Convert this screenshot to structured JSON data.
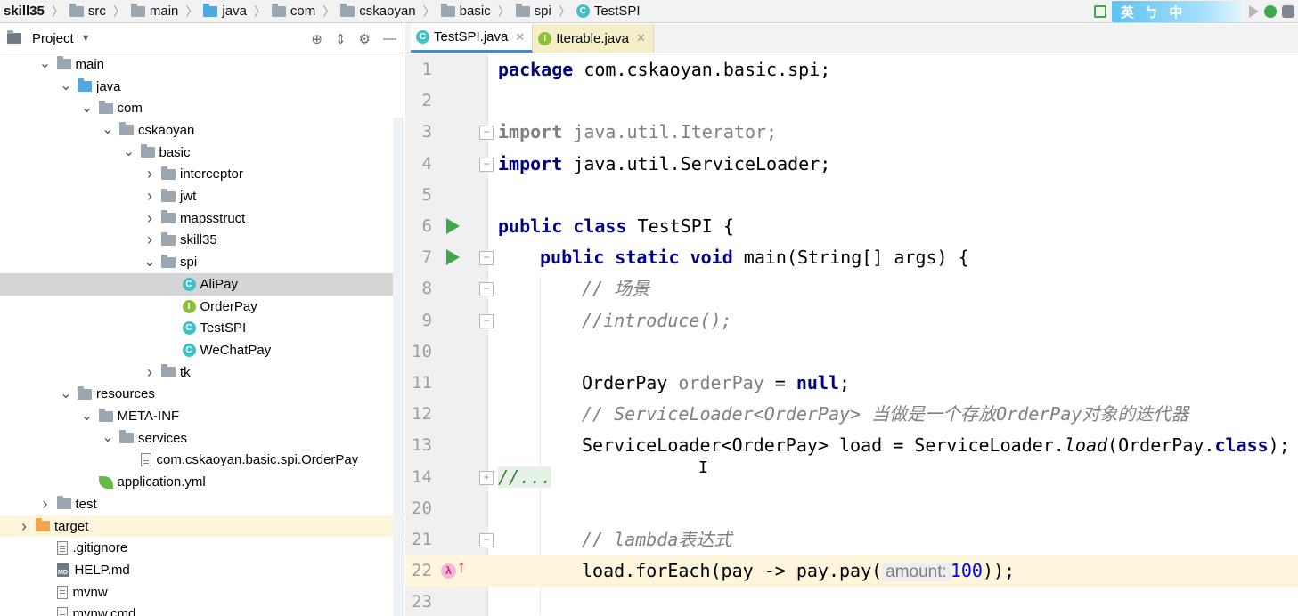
{
  "breadcrumb": [
    {
      "label": "skill35",
      "icon": "none"
    },
    {
      "label": "src",
      "icon": "folder"
    },
    {
      "label": "main",
      "icon": "folder"
    },
    {
      "label": "java",
      "icon": "folder-blue"
    },
    {
      "label": "com",
      "icon": "folder"
    },
    {
      "label": "cskaoyan",
      "icon": "folder"
    },
    {
      "label": "basic",
      "icon": "folder"
    },
    {
      "label": "spi",
      "icon": "folder"
    },
    {
      "label": "TestSPI",
      "icon": "class"
    }
  ],
  "toolbar": {
    "ime_text": "英 ㄅ 中"
  },
  "project_panel": {
    "title": "Project",
    "tree": [
      {
        "label": "main",
        "depth": 2,
        "expanded": true,
        "icon": "folder"
      },
      {
        "label": "java",
        "depth": 3,
        "expanded": true,
        "icon": "folder-blue"
      },
      {
        "label": "com",
        "depth": 4,
        "expanded": true,
        "icon": "folder"
      },
      {
        "label": "cskaoyan",
        "depth": 5,
        "expanded": true,
        "icon": "folder"
      },
      {
        "label": "basic",
        "depth": 6,
        "expanded": true,
        "icon": "folder"
      },
      {
        "label": "interceptor",
        "depth": 7,
        "expanded": false,
        "icon": "folder"
      },
      {
        "label": "jwt",
        "depth": 7,
        "expanded": false,
        "icon": "folder"
      },
      {
        "label": "mapsstruct",
        "depth": 7,
        "expanded": false,
        "icon": "folder"
      },
      {
        "label": "skill35",
        "depth": 7,
        "expanded": false,
        "icon": "folder"
      },
      {
        "label": "spi",
        "depth": 7,
        "expanded": true,
        "icon": "folder"
      },
      {
        "label": "AliPay",
        "depth": 8,
        "icon": "class",
        "selected": true
      },
      {
        "label": "OrderPay",
        "depth": 8,
        "icon": "interface"
      },
      {
        "label": "TestSPI",
        "depth": 8,
        "icon": "class"
      },
      {
        "label": "WeChatPay",
        "depth": 8,
        "icon": "class"
      },
      {
        "label": "tk",
        "depth": 7,
        "expanded": false,
        "icon": "folder"
      },
      {
        "label": "resources",
        "depth": 3,
        "expanded": true,
        "icon": "folder"
      },
      {
        "label": "META-INF",
        "depth": 4,
        "expanded": true,
        "icon": "folder"
      },
      {
        "label": "services",
        "depth": 5,
        "expanded": true,
        "icon": "folder"
      },
      {
        "label": "com.cskaoyan.basic.spi.OrderPay",
        "depth": 6,
        "icon": "file"
      },
      {
        "label": "application.yml",
        "depth": 4,
        "icon": "leaf"
      },
      {
        "label": "test",
        "depth": 2,
        "expanded": false,
        "icon": "folder"
      },
      {
        "label": "target",
        "depth": 1,
        "expanded": false,
        "icon": "folder-orange",
        "highlighted": true
      },
      {
        "label": ".gitignore",
        "depth": 2,
        "icon": "file"
      },
      {
        "label": "HELP.md",
        "depth": 2,
        "icon": "md"
      },
      {
        "label": "mvnw",
        "depth": 2,
        "icon": "file"
      },
      {
        "label": "mvnw.cmd",
        "depth": 2,
        "icon": "file"
      }
    ]
  },
  "editor": {
    "tabs": [
      {
        "label": "TestSPI.java",
        "icon": "class",
        "active": true
      },
      {
        "label": "Iterable.java",
        "icon": "interface",
        "active": false
      }
    ],
    "lines": [
      {
        "n": "1"
      },
      {
        "n": "2"
      },
      {
        "n": "3"
      },
      {
        "n": "4"
      },
      {
        "n": "5"
      },
      {
        "n": "6"
      },
      {
        "n": "7"
      },
      {
        "n": "8"
      },
      {
        "n": "9"
      },
      {
        "n": "10"
      },
      {
        "n": "11"
      },
      {
        "n": "12"
      },
      {
        "n": "13"
      },
      {
        "n": "14"
      },
      {
        "n": "20"
      },
      {
        "n": "21"
      },
      {
        "n": "22"
      },
      {
        "n": "23"
      }
    ],
    "code": {
      "l1_kw": "package",
      "l1_rest": " com.cskaoyan.basic.spi;",
      "l3_kw": "import",
      "l3_rest": " java.util.Iterator;",
      "l4_kw": "import",
      "l4_rest": " java.util.ServiceLoader;",
      "l6_kw": "public class",
      "l6_rest": " TestSPI {",
      "l7_kw": "public static void",
      "l7_rest": " main(String[] args) {",
      "l8_cmt": "// 场景",
      "l9_cmt": "//introduce();",
      "l11_type": "OrderPay ",
      "l11_var": "orderPay",
      "l11_eq": " = ",
      "l11_kw": "null",
      "l11_end": ";",
      "l12_cmt": "// ServiceLoader<OrderPay> 当做是一个存放OrderPay对象的迭代器",
      "l13_a": "ServiceLoader<OrderPay> load = ServiceLoader.",
      "l13_static": "load",
      "l13_b": "(OrderPay.",
      "l13_kw": "class",
      "l13_c": ");",
      "l14_fold": "//...",
      "l21_cmt": "// lambda表达式",
      "l22_a": "load.forEach(pay -> pay.pay(",
      "l22_hint": "amount:",
      "l22_num": "100",
      "l22_b": "));"
    }
  }
}
